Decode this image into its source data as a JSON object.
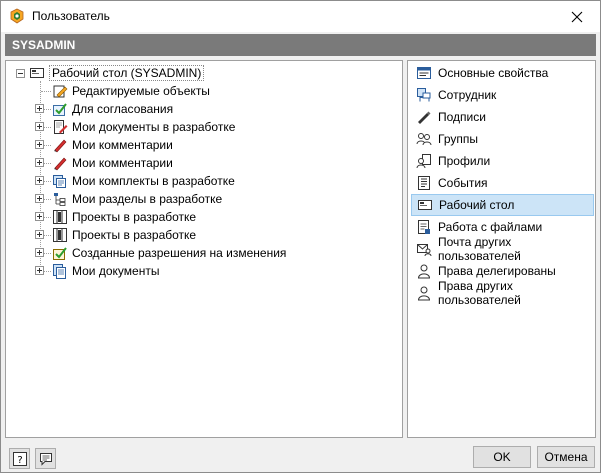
{
  "window": {
    "title": "Пользователь",
    "close_glyph": "✕"
  },
  "header": {
    "user": "SYSADMIN"
  },
  "tree": {
    "root_label": "Рабочий стол (SYSADMIN)",
    "items": [
      {
        "label": "Редактируемые объекты",
        "icon": "edit-objects-icon",
        "expandable": false
      },
      {
        "label": "Для согласования",
        "icon": "approval-icon",
        "expandable": true
      },
      {
        "label": "Мои документы в разработке",
        "icon": "document-edit-icon",
        "expandable": true
      },
      {
        "label": "Мои комментарии",
        "icon": "comment-pen-icon",
        "expandable": true
      },
      {
        "label": "Мои комментарии",
        "icon": "comment-pen-icon",
        "expandable": true
      },
      {
        "label": "Мои комплекты в разработке",
        "icon": "kit-icon",
        "expandable": true
      },
      {
        "label": "Мои разделы в разработке",
        "icon": "section-tree-icon",
        "expandable": true
      },
      {
        "label": "Проекты в разработке",
        "icon": "project-icon",
        "expandable": true
      },
      {
        "label": "Проекты в разработке",
        "icon": "project-icon",
        "expandable": true
      },
      {
        "label": "Созданные разрешения на изменения",
        "icon": "change-permit-icon",
        "expandable": true
      },
      {
        "label": "Мои документы",
        "icon": "documents-icon",
        "expandable": true
      }
    ]
  },
  "nav": {
    "items": [
      {
        "label": "Основные свойства",
        "icon": "properties-icon"
      },
      {
        "label": "Сотрудник",
        "icon": "employee-icon"
      },
      {
        "label": "Подписи",
        "icon": "signature-icon"
      },
      {
        "label": "Группы",
        "icon": "groups-icon"
      },
      {
        "label": "Профили",
        "icon": "profiles-icon"
      },
      {
        "label": "События",
        "icon": "events-icon"
      },
      {
        "label": "Рабочий стол",
        "icon": "desktop-icon"
      },
      {
        "label": "Работа с файлами",
        "icon": "files-icon"
      },
      {
        "label": "Почта других пользователей",
        "icon": "mail-user-icon"
      },
      {
        "label": "Права делегированы",
        "icon": "user-icon"
      },
      {
        "label": "Права других пользователей",
        "icon": "user-icon"
      }
    ],
    "selected_index": 6
  },
  "footer": {
    "help_glyph": "?",
    "ok_label": "OK",
    "cancel_label": "Отмена"
  },
  "colors": {
    "header_bg": "#7a7a7a",
    "selected_bg": "#cce4f7",
    "selected_border": "#99c9ef"
  }
}
